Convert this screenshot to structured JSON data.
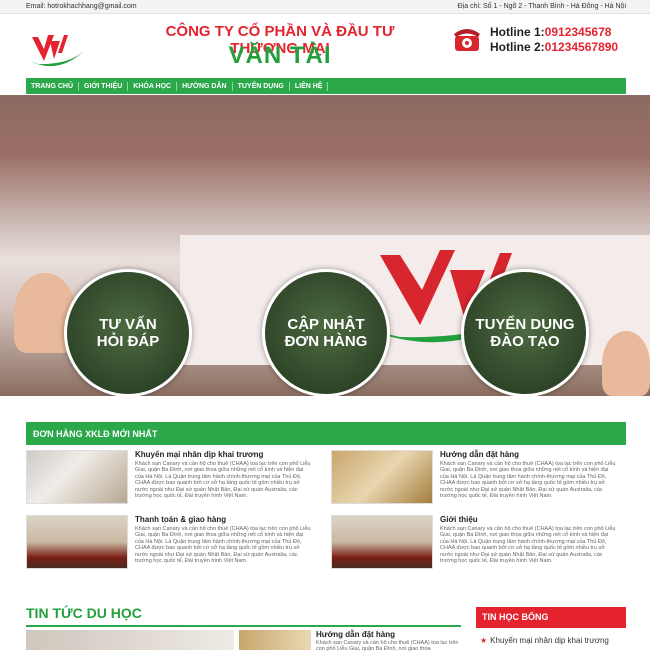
{
  "topbar": {
    "email": "Email: hotrokhachhang@gmail.com",
    "address": "Địa chỉ: Số 1 - Ngõ 2 - Thanh Bình - Hà Đông - Hà Nội"
  },
  "header": {
    "company": "CÔNG TY CỔ PHẦN VÀ ĐẦU TƯ THƯƠNG MẠI",
    "brand": "VĂN TÀI",
    "hotline1_label": "Hotline 1:",
    "hotline1_number": "0912345678",
    "hotline2_label": "Hotline 2:",
    "hotline2_number": "01234567890"
  },
  "nav": {
    "items": [
      "TRANG CHỦ",
      "GIỚI THIỆU",
      "KHÓA HỌC",
      "HƯỚNG DẪN",
      "TUYỂN DỤNG",
      "LIÊN HỆ"
    ]
  },
  "hero": {
    "circle1_line1": "TƯ VẤN",
    "circle1_line2": "HỎI ĐÁP",
    "circle2_line1": "CẬP NHẬT",
    "circle2_line2": "ĐƠN HÀNG",
    "circle3_line1": "TUYỂN DỤNG",
    "circle3_line2": "ĐÀO TẠO"
  },
  "orders": {
    "title": "ĐƠN HÀNG XKLĐ MỚI NHẤT",
    "cards": [
      {
        "title": "Khuyến mại nhân dịp khai trương",
        "desc": "Khách sạn Canary và cần hộ cho thuê (CHAA) tọa lạc trên con phố Liễu Giai, quận Ba Đình, nơi giao thoa giữa những nét cổ kính và hiện đại của Hà Nội. Là Quận trung tâm hành chính-thương mại của Thủ Đô, CHAA được bao quanh bởi cơ sở hạ tầng quốc tế gồm nhiều trụ sở nước ngoài như Đại sứ quán Nhật Bản, Đại sứ quán Australia, các trường học quốc tế, Đài truyền hình Việt Nam."
      },
      {
        "title": "Hướng dẫn đặt hàng",
        "desc": "Khách sạn Canary và cần hộ cho thuê (CHAA) tọa lạc trên con phố Liễu Giai, quận Ba Đình, nơi giao thoa giữa những nét cổ kính và hiện đại của Hà Nội. Là Quận trung tâm hành chính-thương mại của Thủ Đô, CHAA được bao quanh bởi cơ sở hạ tầng quốc tế gồm nhiều trụ sở nước ngoài như Đại sứ quán Nhật Bản, Đại sứ quán Australia, các trường học quốc tế, Đài truyền hình Việt Nam."
      },
      {
        "title": "Thanh toán & giao hàng",
        "desc": "Khách sạn Canary và cần hộ cho thuê (CHAA) tọa lạc trên con phố Liễu Giai, quận Ba Đình, nơi giao thoa giữa những nét cổ kính và hiện đại của Hà Nội. Là Quận trung tâm hành chính-thương mại của Thủ Đô, CHAA được bao quanh bởi cơ sở hạ tầng quốc tế gồm nhiều trụ sở nước ngoài như Đại sứ quán Nhật Bản, Đại sứ quán Australia, các trường học quốc tế, Đài truyền hình Việt Nam."
      },
      {
        "title": "Giới thiệu",
        "desc": "Khách sạn Canary và cần hộ cho thuê (CHAA) tọa lạc trên con phố Liễu Giai, quận Ba Đình, nơi giao thoa giữa những nét cổ kính và hiện đại của Hà Nội. Là Quận trung tâm hành chính-thương mại của Thủ Đô, CHAA được bao quanh bởi cơ sở hạ tầng quốc tế gồm nhiều trụ sở nước ngoài như Đại sứ quán Nhật Bản, Đại sứ quán Australia, các trường học quốc tế, Đài truyền hình Việt Nam."
      }
    ]
  },
  "news": {
    "title": "TIN TỨC DU HỌC",
    "item_title": "Hướng dẫn đặt hàng",
    "item_desc": "Khách sạn Canary và cần hộ cho thuê (CHAA) tọa lạc trên con phố Liễu Giai, quận Ba Đình, nơi giao thoa"
  },
  "sidebar": {
    "title": "TIN HỌC BỔNG",
    "item1": "Khuyến mại nhân dịp khai trương"
  },
  "colors": {
    "green": "#2aa84a",
    "red": "#e4232f"
  }
}
